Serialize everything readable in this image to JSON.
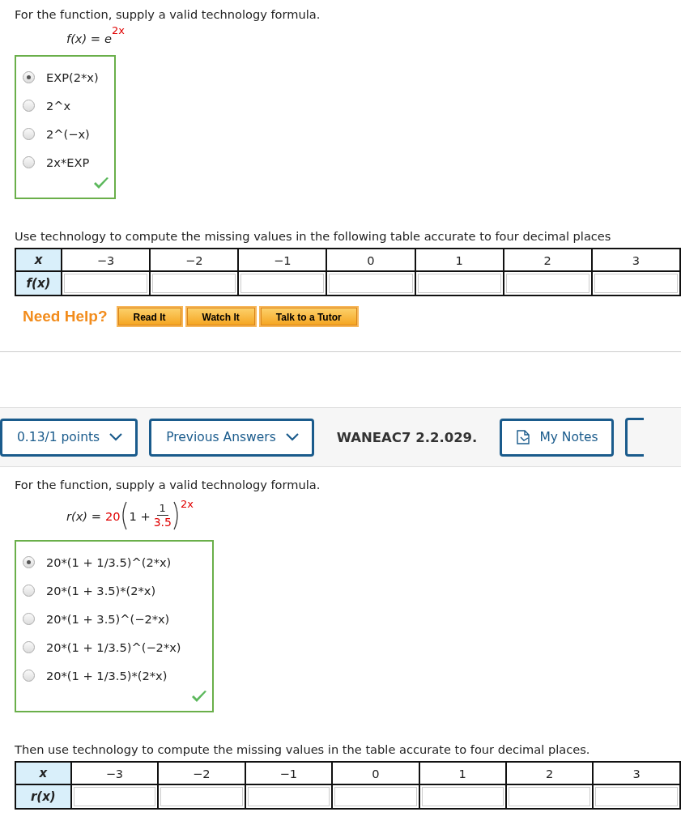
{
  "problem_1": {
    "prompt": "For the function, supply a valid technology formula.",
    "formula": {
      "kind": "exponential",
      "lhs": "f(x) =",
      "base": "e",
      "exponent": "2x"
    },
    "choices": [
      {
        "label": "EXP(2*x)",
        "selected": true
      },
      {
        "label": "2^x",
        "selected": false
      },
      {
        "label": "2^(−x)",
        "selected": false
      },
      {
        "label": "2x*EXP",
        "selected": false
      }
    ],
    "correct": true,
    "table_prompt": "Use technology to compute the missing values in the following table accurate to four decimal places",
    "table": {
      "x_label": "x",
      "x_values": [
        "−3",
        "−2",
        "−1",
        "0",
        "1",
        "2",
        "3"
      ],
      "row_label": "f(x)"
    },
    "help": {
      "label": "Need Help?",
      "buttons": [
        "Read It",
        "Watch It",
        "Talk to a Tutor"
      ]
    }
  },
  "header_bar": {
    "points": "0.13/1 points",
    "previous": "Previous Answers",
    "code": "WANEAC7 2.2.029.",
    "notes": "My Notes"
  },
  "problem_2": {
    "prompt": "For the function, supply a valid technology formula.",
    "formula": {
      "kind": "growth",
      "lhs": "r(x) =",
      "coefficient": "20",
      "inner": "1 +",
      "numerator": "1",
      "denominator": "3.5",
      "exponent": "2x"
    },
    "choices": [
      {
        "label": "20*(1 + 1/3.5)^(2*x)",
        "selected": true
      },
      {
        "label": "20*(1 + 3.5)*(2*x)",
        "selected": false
      },
      {
        "label": "20*(1 + 3.5)^(−2*x)",
        "selected": false
      },
      {
        "label": "20*(1 + 1/3.5)^(−2*x)",
        "selected": false
      },
      {
        "label": "20*(1 + 1/3.5)*(2*x)",
        "selected": false
      }
    ],
    "correct": true,
    "table_prompt": "Then use technology to compute the missing values in the table accurate to four decimal places.",
    "table": {
      "x_label": "x",
      "x_values": [
        "−3",
        "−2",
        "−1",
        "0",
        "1",
        "2",
        "3"
      ],
      "row_label": "r(x)"
    }
  }
}
